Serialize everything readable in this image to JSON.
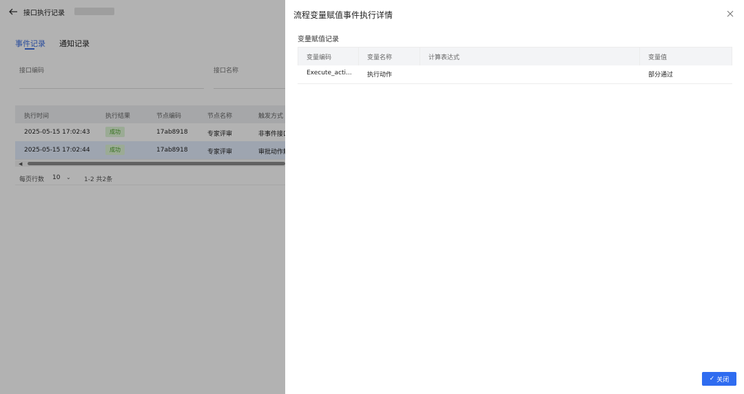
{
  "header": {
    "title": "接口执行记录"
  },
  "tabs": [
    {
      "label": "事件记录"
    },
    {
      "label": "通知记录"
    }
  ],
  "filters": {
    "code_label": "接口编码",
    "name_label": "接口名称"
  },
  "exec_table": {
    "columns": [
      "执行时间",
      "执行结果",
      "节点编码",
      "节点名称",
      "触发方式"
    ],
    "rows": [
      {
        "time": "2025-05-15 17:02:43",
        "result": "成功",
        "node_code": "17ab8918",
        "node_name": "专家评审",
        "trigger": "非事件接口"
      },
      {
        "time": "2025-05-15 17:02:44",
        "result": "成功",
        "node_code": "17ab8918",
        "node_name": "专家评审",
        "trigger": "审批动作触发"
      }
    ]
  },
  "pagination": {
    "rows_per_page_label": "每页行数",
    "page_size": "10",
    "range": "1-2 共2条"
  },
  "drawer": {
    "title": "流程变量赋值事件执行详情",
    "section_title": "变量赋值记录",
    "columns": [
      "变量编码",
      "变量名称",
      "计算表达式",
      "变量值"
    ],
    "rows": [
      {
        "code": "Execute_acti...",
        "name": "执行动作",
        "expression": "",
        "value": "部分通过"
      }
    ],
    "close_label": "关闭"
  },
  "colors": {
    "primary": "#2f6cf0",
    "success_text": "#4ba32a",
    "success_bg": "#dff5d6",
    "selected_row": "#e3ecfc"
  }
}
